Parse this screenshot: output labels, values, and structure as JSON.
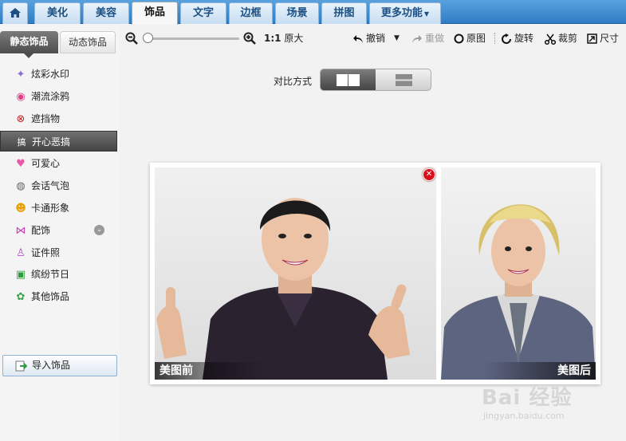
{
  "top_tabs": [
    {
      "label": "美化"
    },
    {
      "label": "美容"
    },
    {
      "label": "饰品",
      "active": true
    },
    {
      "label": "文字"
    },
    {
      "label": "边框"
    },
    {
      "label": "场景"
    },
    {
      "label": "拼图"
    },
    {
      "label": "更多功能"
    }
  ],
  "sub_tabs": {
    "static": "静态饰品",
    "dynamic": "动态饰品"
  },
  "categories": [
    {
      "label": "炫彩水印",
      "icon": "sparkle-icon"
    },
    {
      "label": "潮流涂鸦",
      "icon": "lips-icon"
    },
    {
      "label": "遮挡物",
      "icon": "mask-icon"
    },
    {
      "label": "开心恶搞",
      "icon": "funny-icon"
    },
    {
      "label": "可爱心",
      "icon": "heart-icon"
    },
    {
      "label": "会话气泡",
      "icon": "speech-bubble-icon"
    },
    {
      "label": "卡通形象",
      "icon": "cartoon-face-icon"
    },
    {
      "label": "配饰",
      "icon": "bow-icon"
    },
    {
      "label": "证件照",
      "icon": "shirt-icon"
    },
    {
      "label": "缤纷节日",
      "icon": "gift-icon"
    },
    {
      "label": "其他饰品",
      "icon": "flower-icon"
    }
  ],
  "import_button": "导入饰品",
  "toolbar": {
    "one_to_one": "1:1",
    "original_size": "原大",
    "undo": "撤销",
    "redo": "重做",
    "original": "原图",
    "rotate": "旋转",
    "crop": "裁剪",
    "resize": "尺寸"
  },
  "compare": {
    "label": "对比方式"
  },
  "photos": {
    "before": "美图前",
    "after": "美图后"
  },
  "watermark": {
    "brand": "Bai 经验",
    "url": "jingyan.baidu.com"
  }
}
